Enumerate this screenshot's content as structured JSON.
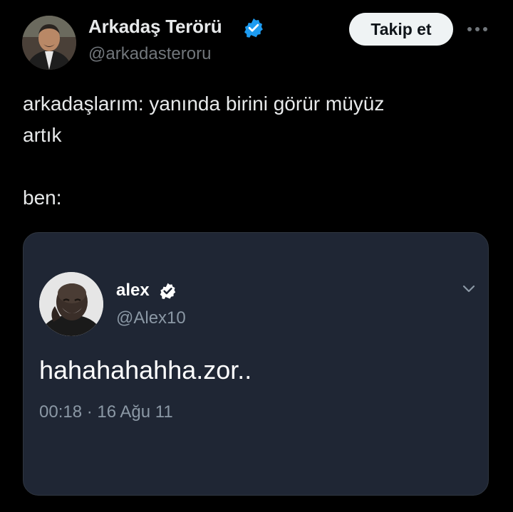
{
  "tweet": {
    "author": {
      "display_name": "Arkadaş Terörü",
      "handle": "@arkadasteroru",
      "verified": true,
      "avatar_icon": "avatar-photo-man"
    },
    "follow_label": "Takip et",
    "more_icon": "more-horizontal-icon",
    "text": "arkadaşlarım: yanında birini görür müyüz\nartık\n\nben:",
    "embed": {
      "author": {
        "display_name": "alex",
        "handle": "@Alex10",
        "verified": true,
        "avatar_icon": "avatar-photo-laughing-man"
      },
      "text": "hahahahahha.zor..",
      "timestamp": "00:18 · 16 Ağu 11",
      "menu_icon": "chevron-down-icon"
    }
  },
  "colors": {
    "background": "#000000",
    "text_primary": "#e7e9ea",
    "text_secondary": "#71767b",
    "verified": "#1d9bf0",
    "follow_button_bg": "#eff3f4",
    "embed_card_bg": "#1f2634"
  }
}
